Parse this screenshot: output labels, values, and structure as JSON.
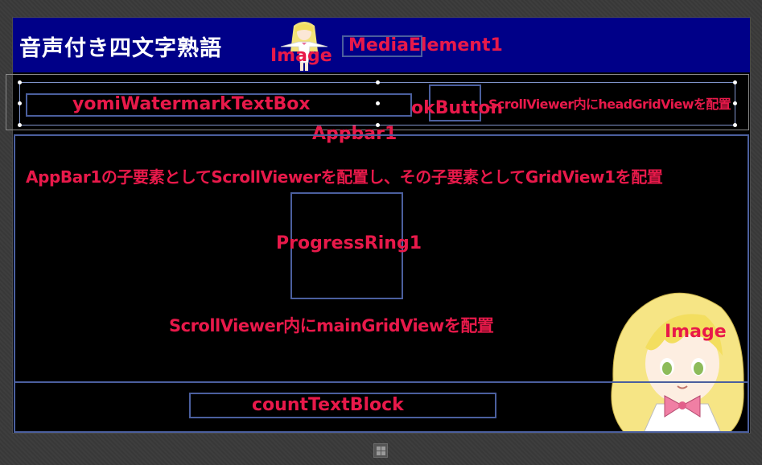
{
  "header": {
    "title": "音声付き四文字熟語",
    "image_label": "Image",
    "media_label": "MediaElement1"
  },
  "appbar": {
    "textbox_label": "yomiWatermarkTextBox",
    "ok_label": "okButton",
    "scroll_note": "ScrollViewer内にheadGridViewを配置",
    "name_label": "Appbar1"
  },
  "main": {
    "appbar_note": "AppBar1の子要素としてScrollViewerを配置し、その子要素としてGridView1を配置",
    "progress_label": "ProgressRing1",
    "scroll_note": "ScrollViewer内にmainGridViewを配置",
    "image_label": "Image"
  },
  "footer": {
    "count_label": "countTextBlock"
  },
  "colors": {
    "header_bg": "#000088",
    "label": "#e8194a",
    "frame": "#4b5f9e",
    "canvas": "#000000"
  },
  "icons": [
    "girl-small-image",
    "girl-large-image",
    "windows-icon"
  ]
}
